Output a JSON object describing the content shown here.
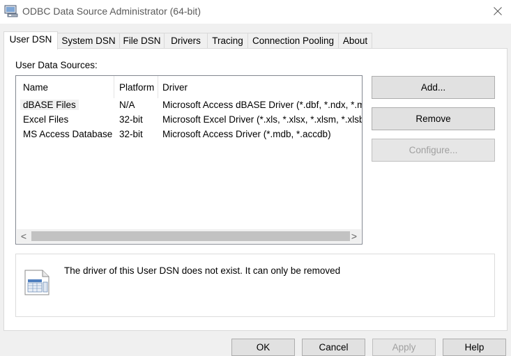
{
  "window": {
    "title": "ODBC Data Source Administrator (64-bit)",
    "close_symbol": "✕"
  },
  "tabs": [
    {
      "label": "User DSN",
      "active": true
    },
    {
      "label": "System DSN",
      "active": false
    },
    {
      "label": "File DSN",
      "active": false
    },
    {
      "label": "Drivers",
      "active": false
    },
    {
      "label": "Tracing",
      "active": false
    },
    {
      "label": "Connection Pooling",
      "active": false
    },
    {
      "label": "About",
      "active": false
    }
  ],
  "user_dsn": {
    "section_label": "User Data Sources:",
    "columns": [
      "Name",
      "Platform",
      "Driver"
    ],
    "rows": [
      {
        "name": "dBASE Files",
        "platform": "N/A",
        "driver": "Microsoft Access dBASE Driver (*.dbf, *.ndx, *.m",
        "selected": true
      },
      {
        "name": "Excel Files",
        "platform": "32-bit",
        "driver": "Microsoft Excel Driver (*.xls, *.xlsx, *.xlsm, *.xlsb)",
        "selected": false
      },
      {
        "name": "MS Access Database",
        "platform": "32-bit",
        "driver": "Microsoft Access Driver (*.mdb, *.accdb)",
        "selected": false
      }
    ],
    "scroll_left": "<",
    "scroll_right": ">",
    "buttons": {
      "add": "Add...",
      "remove": "Remove",
      "configure": "Configure..."
    },
    "info_text": "The driver of this User DSN does not exist. It can only be removed"
  },
  "footer_buttons": {
    "ok": "OK",
    "cancel": "Cancel",
    "apply": "Apply",
    "help": "Help"
  },
  "icons": {
    "app": "odbc-admin-icon",
    "info": "data-source-icon",
    "close": "close-icon"
  }
}
